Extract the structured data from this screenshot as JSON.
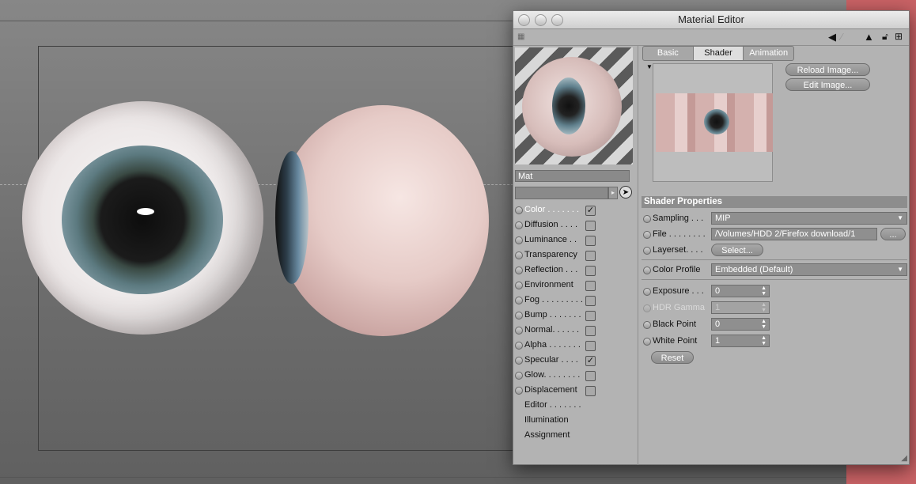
{
  "window": {
    "title": "Material Editor"
  },
  "material": {
    "name": "Mat"
  },
  "channels": [
    {
      "label": "Color . . . . . . .",
      "checked": true,
      "active": true
    },
    {
      "label": "Diffusion . . . .",
      "checked": false
    },
    {
      "label": "Luminance . .",
      "checked": false
    },
    {
      "label": "Transparency",
      "checked": false
    },
    {
      "label": "Reflection . . .",
      "checked": false
    },
    {
      "label": "Environment",
      "checked": false
    },
    {
      "label": "Fog . . . . . . . . .",
      "checked": false
    },
    {
      "label": "Bump . . . . . . .",
      "checked": false
    },
    {
      "label": "Normal. . . . . .",
      "checked": false
    },
    {
      "label": "Alpha . . . . . . .",
      "checked": false
    },
    {
      "label": "Specular . . . .",
      "checked": true
    },
    {
      "label": "Glow. . . . . . . .",
      "checked": false
    },
    {
      "label": "Displacement",
      "checked": false
    }
  ],
  "extra_items": [
    "Editor . . . . . . .",
    "Illumination",
    "Assignment"
  ],
  "tabs": [
    "Basic",
    "Shader",
    "Animation"
  ],
  "active_tab": "Shader",
  "buttons": {
    "reload_image": "Reload Image...",
    "edit_image": "Edit Image...",
    "select": "Select...",
    "browse": "...",
    "reset": "Reset"
  },
  "shader": {
    "heading": "Shader Properties",
    "sampling_label": "Sampling . . .",
    "sampling_value": "MIP",
    "file_label": "File . . . . . . . .",
    "file_value": "/Volumes/HDD 2/Firefox download/1",
    "layerset_label": "Layerset. . . .",
    "color_profile_label": "Color Profile",
    "color_profile_value": "Embedded (Default)",
    "exposure_label": "Exposure . . .",
    "exposure_value": "0",
    "hdr_gamma_label": "HDR Gamma",
    "hdr_gamma_value": "1",
    "black_point_label": "Black Point",
    "black_point_value": "0",
    "white_point_label": "White Point",
    "white_point_value": "1"
  },
  "toolbar_icons": [
    "grip-icon",
    "arrow-left-icon",
    "arrow-up-icon",
    "lock-icon",
    "new-window-icon"
  ]
}
